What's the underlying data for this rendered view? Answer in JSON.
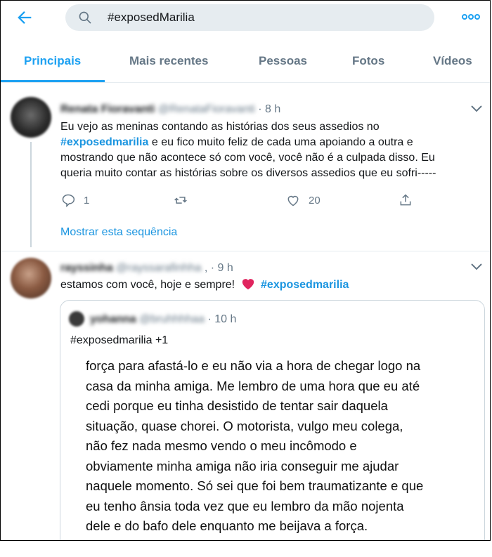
{
  "search": {
    "query": "#exposedMarilia"
  },
  "tabs": [
    {
      "label": "Principais"
    },
    {
      "label": "Mais recentes"
    },
    {
      "label": "Pessoas"
    },
    {
      "label": "Fotos"
    },
    {
      "label": "Vídeos"
    }
  ],
  "tweet1": {
    "name": "Renata Fioravanti",
    "handle": "@RenataFioravanti",
    "time": "· 8 h",
    "lines": [
      "Eu vejo as meninas contando as histórias dos seus assedios no",
      "e eu fico muito feliz de cada uma apoiando a outra e",
      "mostrando que não acontece só com você, você não é a culpada disso. Eu",
      "queria muito contar as histórias sobre os diversos assedios que eu sofri-----"
    ],
    "hashtag": "#exposedmarilia",
    "replies": "1",
    "likes": "20",
    "show_thread": "Mostrar esta sequência"
  },
  "tweet2": {
    "name": "rayssinha",
    "handle": "@rayssarafinhha",
    "separator": ",",
    "time": "· 9 h",
    "text": "estamos com você, hoje e sempre!",
    "hashtag": "#exposedmarilia",
    "heart_color": "#e0245e"
  },
  "quoted": {
    "name": "yohanna",
    "handle": "@bruhhhhaa",
    "time": "· 10 h",
    "caption": "#exposedmarilia +1",
    "image_lines": [
      "força para afastá-lo e eu não via a hora de chegar logo na",
      "casa da minha amiga. Me lembro de uma hora que eu até",
      "cedi porque eu tinha desistido de tentar sair daquela",
      "situação, quase chorei. O motorista, vulgo meu colega,",
      "não fez nada mesmo vendo o meu incômodo e",
      "obviamente minha amiga não iria conseguir me ajudar",
      "naquele momento. Só sei que foi bem traumatizante e que",
      "eu tenho ânsia toda vez que eu lembro da mão nojenta",
      "dele e do bafo dele enquanto me beijava a força."
    ]
  },
  "colors": {
    "accent": "#1da1f2",
    "link": "#1b95e0",
    "muted": "#657786"
  },
  "icons": [
    "back-arrow-icon",
    "search-icon",
    "more-icon",
    "chevron-down-icon",
    "reply-icon",
    "retweet-icon",
    "like-icon",
    "share-icon",
    "heart-emoji-icon"
  ]
}
